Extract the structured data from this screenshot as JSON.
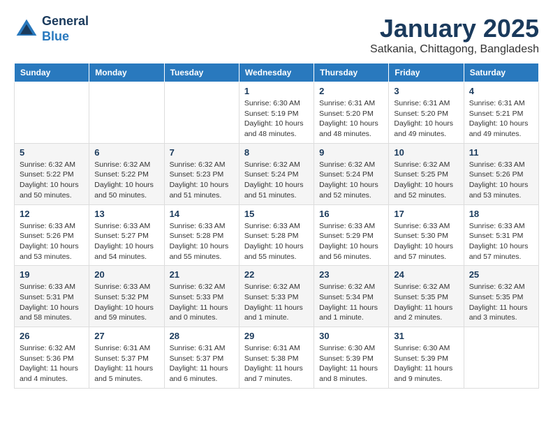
{
  "logo": {
    "line1": "General",
    "line2": "Blue"
  },
  "header": {
    "month": "January 2025",
    "location": "Satkania, Chittagong, Bangladesh"
  },
  "weekdays": [
    "Sunday",
    "Monday",
    "Tuesday",
    "Wednesday",
    "Thursday",
    "Friday",
    "Saturday"
  ],
  "weeks": [
    [
      {
        "day": "",
        "info": ""
      },
      {
        "day": "",
        "info": ""
      },
      {
        "day": "",
        "info": ""
      },
      {
        "day": "1",
        "info": "Sunrise: 6:30 AM\nSunset: 5:19 PM\nDaylight: 10 hours\nand 48 minutes."
      },
      {
        "day": "2",
        "info": "Sunrise: 6:31 AM\nSunset: 5:20 PM\nDaylight: 10 hours\nand 48 minutes."
      },
      {
        "day": "3",
        "info": "Sunrise: 6:31 AM\nSunset: 5:20 PM\nDaylight: 10 hours\nand 49 minutes."
      },
      {
        "day": "4",
        "info": "Sunrise: 6:31 AM\nSunset: 5:21 PM\nDaylight: 10 hours\nand 49 minutes."
      }
    ],
    [
      {
        "day": "5",
        "info": "Sunrise: 6:32 AM\nSunset: 5:22 PM\nDaylight: 10 hours\nand 50 minutes."
      },
      {
        "day": "6",
        "info": "Sunrise: 6:32 AM\nSunset: 5:22 PM\nDaylight: 10 hours\nand 50 minutes."
      },
      {
        "day": "7",
        "info": "Sunrise: 6:32 AM\nSunset: 5:23 PM\nDaylight: 10 hours\nand 51 minutes."
      },
      {
        "day": "8",
        "info": "Sunrise: 6:32 AM\nSunset: 5:24 PM\nDaylight: 10 hours\nand 51 minutes."
      },
      {
        "day": "9",
        "info": "Sunrise: 6:32 AM\nSunset: 5:24 PM\nDaylight: 10 hours\nand 52 minutes."
      },
      {
        "day": "10",
        "info": "Sunrise: 6:32 AM\nSunset: 5:25 PM\nDaylight: 10 hours\nand 52 minutes."
      },
      {
        "day": "11",
        "info": "Sunrise: 6:33 AM\nSunset: 5:26 PM\nDaylight: 10 hours\nand 53 minutes."
      }
    ],
    [
      {
        "day": "12",
        "info": "Sunrise: 6:33 AM\nSunset: 5:26 PM\nDaylight: 10 hours\nand 53 minutes."
      },
      {
        "day": "13",
        "info": "Sunrise: 6:33 AM\nSunset: 5:27 PM\nDaylight: 10 hours\nand 54 minutes."
      },
      {
        "day": "14",
        "info": "Sunrise: 6:33 AM\nSunset: 5:28 PM\nDaylight: 10 hours\nand 55 minutes."
      },
      {
        "day": "15",
        "info": "Sunrise: 6:33 AM\nSunset: 5:28 PM\nDaylight: 10 hours\nand 55 minutes."
      },
      {
        "day": "16",
        "info": "Sunrise: 6:33 AM\nSunset: 5:29 PM\nDaylight: 10 hours\nand 56 minutes."
      },
      {
        "day": "17",
        "info": "Sunrise: 6:33 AM\nSunset: 5:30 PM\nDaylight: 10 hours\nand 57 minutes."
      },
      {
        "day": "18",
        "info": "Sunrise: 6:33 AM\nSunset: 5:31 PM\nDaylight: 10 hours\nand 57 minutes."
      }
    ],
    [
      {
        "day": "19",
        "info": "Sunrise: 6:33 AM\nSunset: 5:31 PM\nDaylight: 10 hours\nand 58 minutes."
      },
      {
        "day": "20",
        "info": "Sunrise: 6:33 AM\nSunset: 5:32 PM\nDaylight: 10 hours\nand 59 minutes."
      },
      {
        "day": "21",
        "info": "Sunrise: 6:32 AM\nSunset: 5:33 PM\nDaylight: 11 hours\nand 0 minutes."
      },
      {
        "day": "22",
        "info": "Sunrise: 6:32 AM\nSunset: 5:33 PM\nDaylight: 11 hours\nand 1 minute."
      },
      {
        "day": "23",
        "info": "Sunrise: 6:32 AM\nSunset: 5:34 PM\nDaylight: 11 hours\nand 1 minute."
      },
      {
        "day": "24",
        "info": "Sunrise: 6:32 AM\nSunset: 5:35 PM\nDaylight: 11 hours\nand 2 minutes."
      },
      {
        "day": "25",
        "info": "Sunrise: 6:32 AM\nSunset: 5:35 PM\nDaylight: 11 hours\nand 3 minutes."
      }
    ],
    [
      {
        "day": "26",
        "info": "Sunrise: 6:32 AM\nSunset: 5:36 PM\nDaylight: 11 hours\nand 4 minutes."
      },
      {
        "day": "27",
        "info": "Sunrise: 6:31 AM\nSunset: 5:37 PM\nDaylight: 11 hours\nand 5 minutes."
      },
      {
        "day": "28",
        "info": "Sunrise: 6:31 AM\nSunset: 5:37 PM\nDaylight: 11 hours\nand 6 minutes."
      },
      {
        "day": "29",
        "info": "Sunrise: 6:31 AM\nSunset: 5:38 PM\nDaylight: 11 hours\nand 7 minutes."
      },
      {
        "day": "30",
        "info": "Sunrise: 6:30 AM\nSunset: 5:39 PM\nDaylight: 11 hours\nand 8 minutes."
      },
      {
        "day": "31",
        "info": "Sunrise: 6:30 AM\nSunset: 5:39 PM\nDaylight: 11 hours\nand 9 minutes."
      },
      {
        "day": "",
        "info": ""
      }
    ]
  ]
}
